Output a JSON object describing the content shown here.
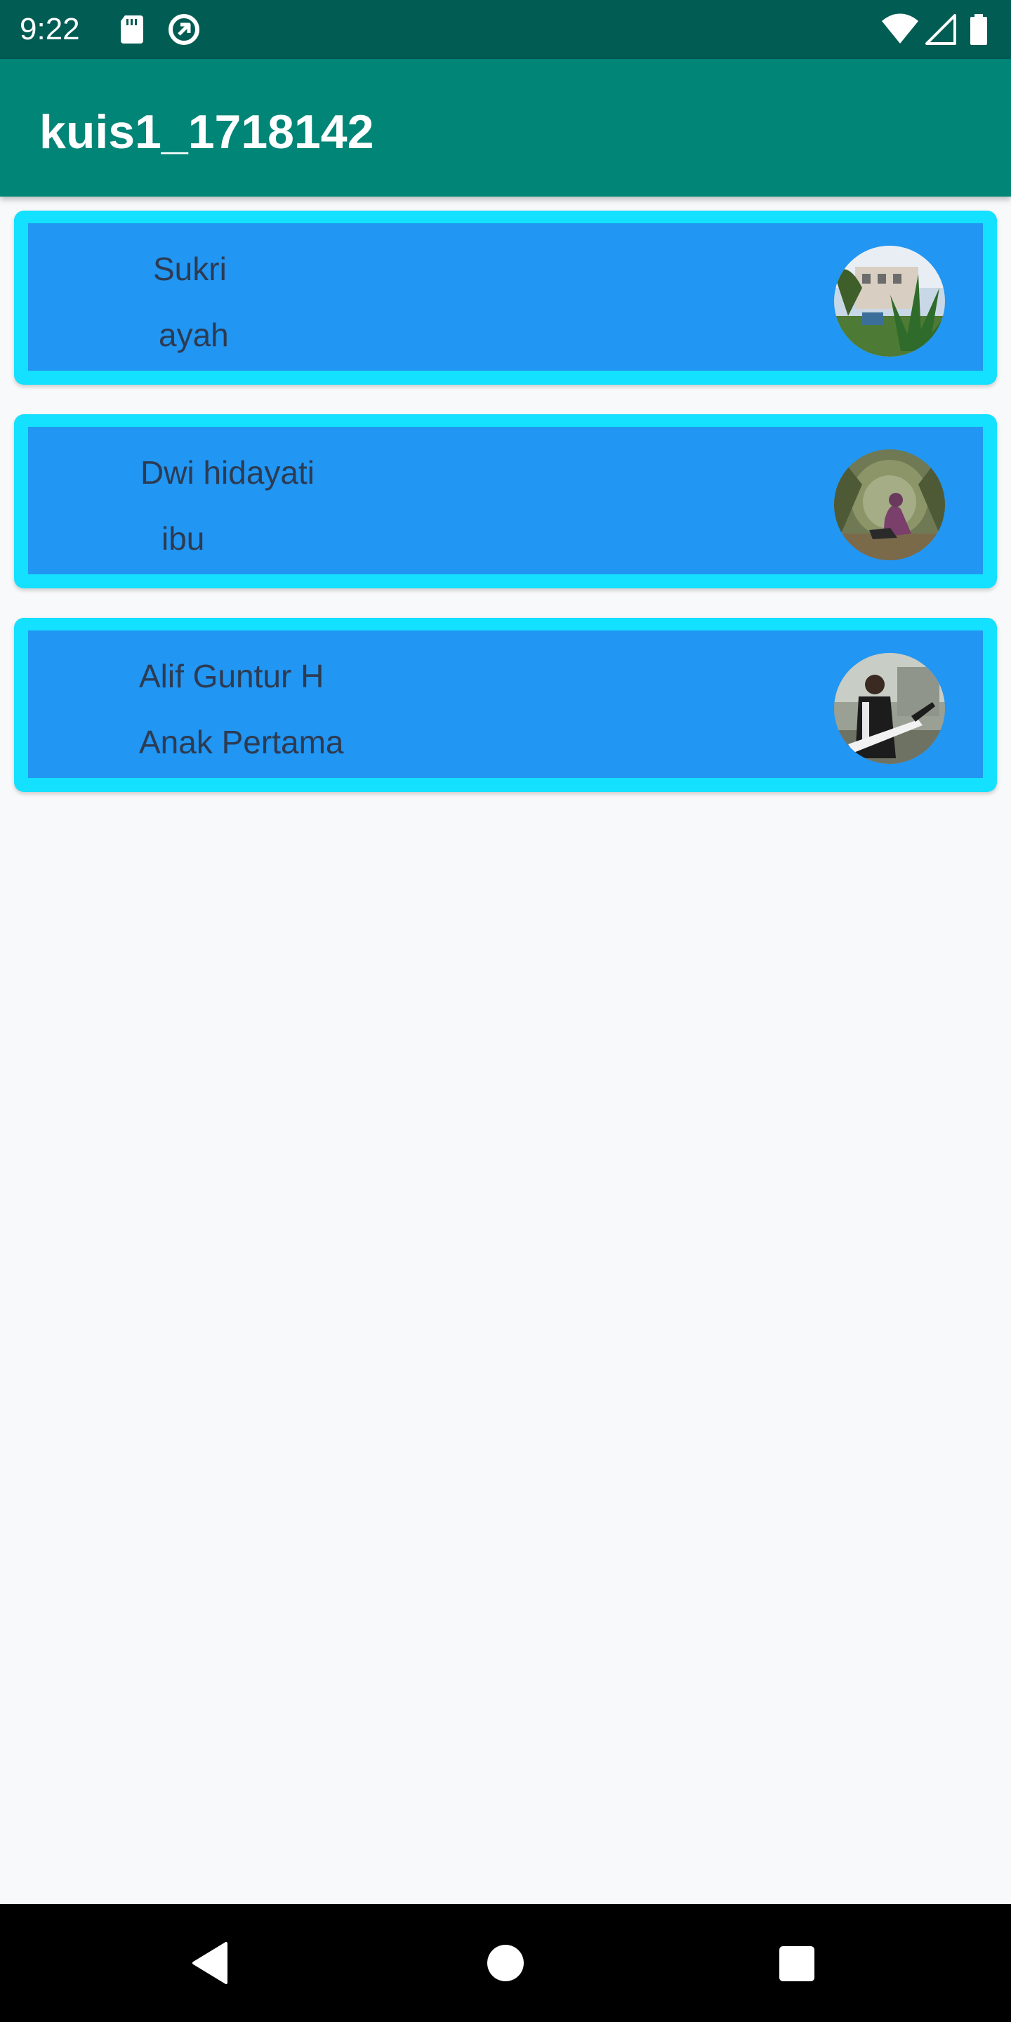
{
  "status_bar": {
    "time": "9:22",
    "left_icons": [
      "sd-card-icon",
      "data-saver-icon"
    ],
    "right_icons": [
      "wifi-icon",
      "cell-signal-icon",
      "battery-icon"
    ]
  },
  "app_bar": {
    "title": "kuis1_1718142",
    "color": "#008577"
  },
  "list": {
    "items": [
      {
        "name": "Sukri",
        "role": "ayah",
        "avatar": "avatar-photo-garden"
      },
      {
        "name": "Dwi hidayati",
        "role": "ibu",
        "avatar": "avatar-photo-forest"
      },
      {
        "name": "Alif Guntur H",
        "role": "Anak Pertama",
        "avatar": "avatar-photo-guitar"
      }
    ],
    "card_border_color": "#14e0ff",
    "card_fill_color": "#2196f3",
    "text_color": "#2d3b52"
  },
  "nav_bar": {
    "buttons": [
      "back-icon",
      "home-icon",
      "recents-icon"
    ]
  }
}
